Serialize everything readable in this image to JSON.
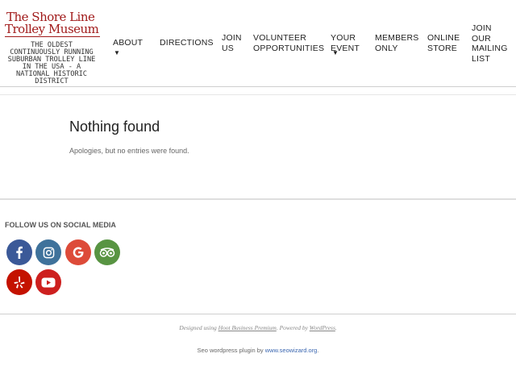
{
  "header": {
    "logo": {
      "line1": "The Shore Line",
      "line2": "Trolley Museum"
    },
    "tagline": "THE OLDEST CONTINUOUSLY RUNNING SUBURBAN TROLLEY LINE IN THE USA - A NATIONAL HISTORIC DISTRICT"
  },
  "nav": {
    "items": [
      {
        "line1": "ABOUT",
        "line2": "",
        "line3": "",
        "line4": "",
        "has_dropdown": true
      },
      {
        "line1": "DIRECTIONS",
        "line2": "",
        "line3": "",
        "line4": "",
        "has_dropdown": false
      },
      {
        "line1": "JOIN",
        "line2": "US",
        "line3": "",
        "line4": "",
        "has_dropdown": false
      },
      {
        "line1": "VOLUNTEER",
        "line2": "OPPORTUNITIES",
        "line3": "",
        "line4": "",
        "has_dropdown": false
      },
      {
        "line1": "YOUR",
        "line2": "EVENT",
        "line3": "",
        "line4": "",
        "has_dropdown": true
      },
      {
        "line1": "MEMBERS",
        "line2": "ONLY",
        "line3": "",
        "line4": "",
        "has_dropdown": false
      },
      {
        "line1": "ONLINE",
        "line2": "STORE",
        "line3": "",
        "line4": "",
        "has_dropdown": false
      },
      {
        "line1": "JOIN",
        "line2": "OUR",
        "line3": "MAILING",
        "line4": "LIST",
        "has_dropdown": false
      }
    ]
  },
  "main": {
    "title": "Nothing found",
    "message": "Apologies, but no entries were found."
  },
  "footer": {
    "widget_title": "FOLLOW US ON SOCIAL MEDIA",
    "social": [
      {
        "icon": "facebook-icon",
        "color": "#3b5998"
      },
      {
        "icon": "instagram-icon",
        "color": "#3f729b"
      },
      {
        "icon": "google-icon",
        "color": "#dd4b39"
      },
      {
        "icon": "tripadvisor-icon",
        "color": "#589442"
      },
      {
        "icon": "yelp-icon",
        "color": "#c41200"
      },
      {
        "icon": "youtube-icon",
        "color": "#cd201f"
      }
    ],
    "credit": {
      "prefix": "Designed using ",
      "theme_link": "Hoot Business Premium",
      "middle": ". Powered by ",
      "wp_link": "WordPress",
      "suffix": "."
    },
    "seo": {
      "prefix": "Seo wordpress plugin by ",
      "link": "www.seowizard.org",
      "suffix": "."
    }
  }
}
